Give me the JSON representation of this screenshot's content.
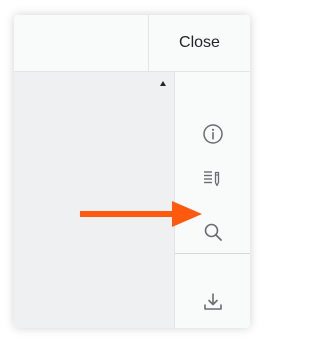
{
  "header": {
    "close_label": "Close"
  },
  "toolbar": {
    "icons": [
      "info-icon",
      "notes-edit-icon",
      "search-icon",
      "download-icon"
    ]
  },
  "annotation": {
    "arrow_color": "#ff5a0f",
    "points_to": "search-icon"
  },
  "colors": {
    "icon": "#6a6e72",
    "panel_bg": "#f9fafa",
    "content_bg": "#eef0f1",
    "border": "#e2e4e6"
  }
}
